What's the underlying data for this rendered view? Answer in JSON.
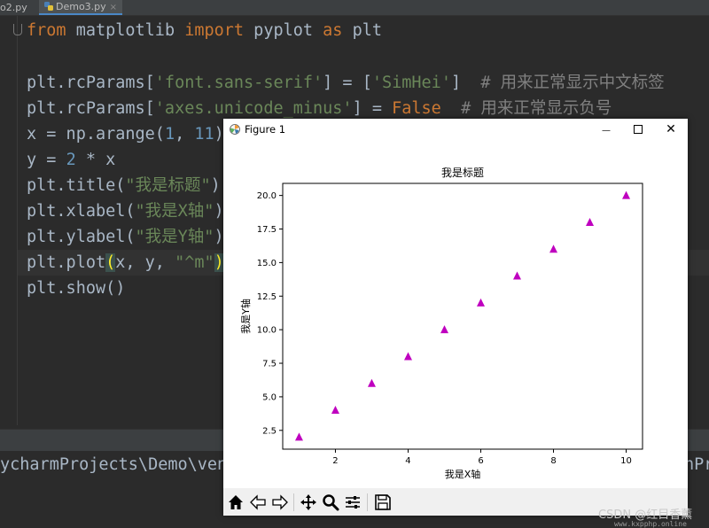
{
  "ide": {
    "tabs": [
      {
        "label": "o2.py",
        "active": false
      },
      {
        "label": "Demo3.py",
        "active": true
      }
    ],
    "code": {
      "l1": {
        "from": "from",
        "mod": " matplotlib ",
        "imp": "import",
        "mod2": " pyplot ",
        "as": "as",
        "alias": " plt"
      },
      "l3": {
        "a": "plt.rcParams[",
        "key": "'font.sans-serif'",
        "b": "] = [",
        "val": "'SimHei'",
        "c": "]  ",
        "comment": "# 用来正常显示中文标签"
      },
      "l4": {
        "a": "plt.rcParams[",
        "key": "'axes.unicode_minus'",
        "b": "] = ",
        "val": "False",
        "c": "  ",
        "comment": "# 用来正常显示负号"
      },
      "l5": {
        "a": "x = np.arange(",
        "n1": "1",
        "b": ", ",
        "n2": "11",
        "c": ")"
      },
      "l6": {
        "a": "y = ",
        "n1": "2",
        "b": " * x"
      },
      "l7": {
        "a": "plt.title(",
        "s": "\"我是标题\"",
        "b": ")"
      },
      "l8": {
        "a": "plt.xlabel(",
        "s": "\"我是X轴\"",
        "b": ")"
      },
      "l9": {
        "a": "plt.ylabel(",
        "s": "\"我是Y轴\"",
        "b": ")"
      },
      "l10": {
        "a": "plt.plot",
        "open": "(",
        "b": "x, y, ",
        "s": "\"^m\"",
        "close": ")"
      },
      "l11": {
        "a": "plt.show()"
      }
    },
    "console": {
      "left": "ycharmProjects\\Demo\\venv\\",
      "right": "nPr"
    }
  },
  "figure_window": {
    "title": "Figure 1",
    "min_glyph": "—",
    "close_glyph": "✕",
    "toolbar": {
      "home": "home-icon",
      "back": "back-arrow-icon",
      "forward": "forward-arrow-icon",
      "pan": "pan-icon",
      "zoom": "zoom-icon",
      "configure": "configure-subplots-icon",
      "save": "save-icon"
    }
  },
  "chart_data": {
    "type": "scatter",
    "title": "我是标题",
    "xlabel": "我是X轴",
    "ylabel": "我是Y轴",
    "x": [
      1,
      2,
      3,
      4,
      5,
      6,
      7,
      8,
      9,
      10
    ],
    "y": [
      2,
      4,
      6,
      8,
      10,
      12,
      14,
      16,
      18,
      20
    ],
    "xticks": [
      2,
      4,
      6,
      8,
      10
    ],
    "yticks": [
      2.5,
      5.0,
      7.5,
      10.0,
      12.5,
      15.0,
      17.5,
      20.0
    ],
    "xlim": [
      0.55,
      10.45
    ],
    "ylim": [
      1.1,
      20.9
    ],
    "marker": "triangle-up",
    "color": "#bf00bf",
    "grid": false
  },
  "watermark": {
    "line1": "CSDN @红目香薰",
    "line2": "www.kxpphp.online"
  }
}
